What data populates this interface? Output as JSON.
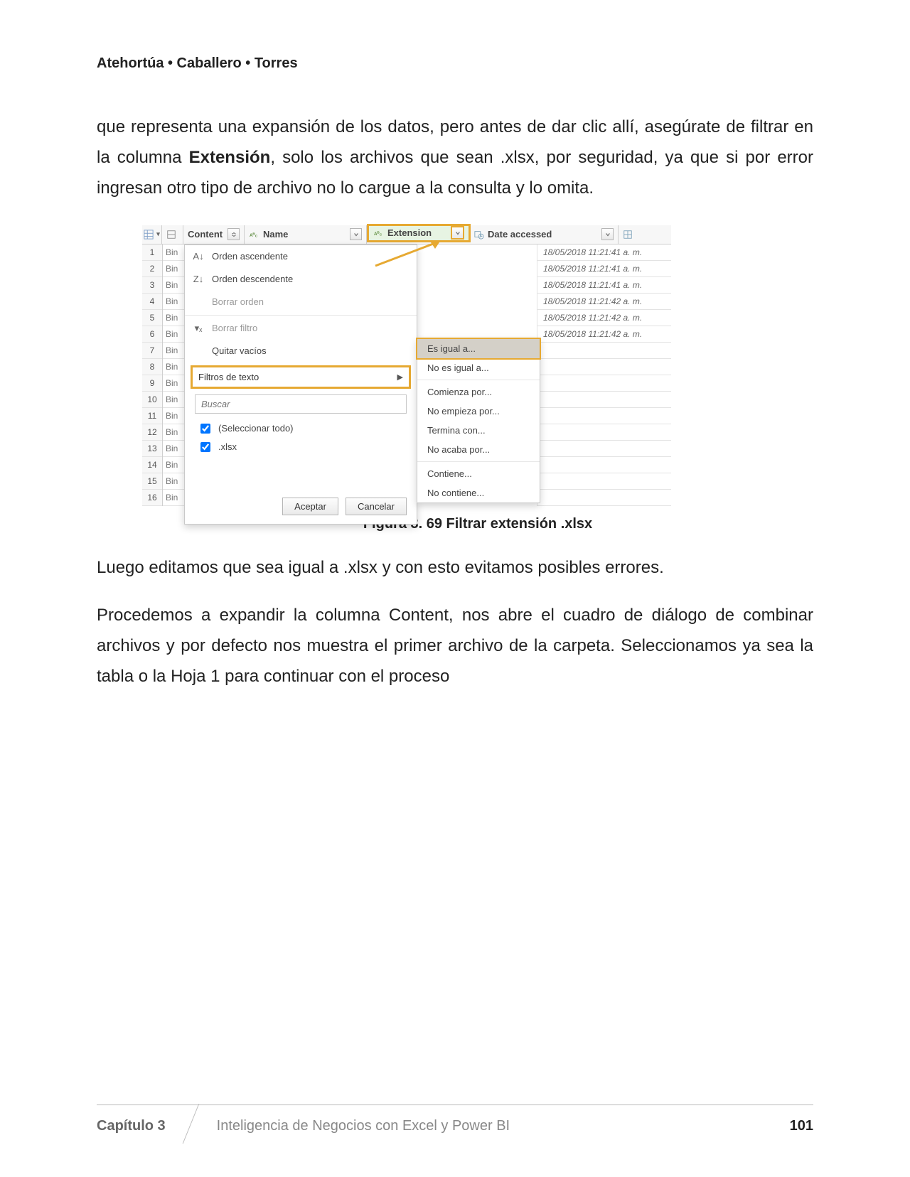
{
  "authors": "Atehortúa • Caballero • Torres",
  "para1_pre": "que representa una expansión de los datos, pero antes de dar clic allí, asegúrate de filtrar en la columna ",
  "para1_bold": "Extensión",
  "para1_post": ", solo los archivos que sean .xlsx, por seguridad, ya que si por error ingresan otro tipo de archivo no lo cargue a la consulta y lo omita.",
  "caption": "Figura 3. 69 Filtrar extensión .xlsx",
  "para2": "Luego editamos que sea igual a .xlsx y con esto evitamos posibles errores.",
  "para3": "Procedemos a expandir la columna Content, nos abre el cuadro de diálogo de combinar archivos y por defecto nos muestra el primer archivo de la carpeta. Seleccionamos ya sea la tabla o la Hoja 1 para continuar con el proceso",
  "footer": {
    "chapter": "Capítulo 3",
    "title": "Inteligencia de Negocios con Excel y Power BI",
    "page": "101"
  },
  "cols": {
    "content": "Content",
    "name": "Name",
    "extension": "Extension",
    "date": "Date accessed"
  },
  "rows": [
    "1",
    "2",
    "3",
    "4",
    "5",
    "6",
    "7",
    "8",
    "9",
    "10",
    "11",
    "12",
    "13",
    "14",
    "15",
    "16"
  ],
  "bin": "Bin",
  "dates": [
    "18/05/2018 11:21:41 a. m.",
    "18/05/2018 11:21:41 a. m.",
    "18/05/2018 11:21:41 a. m.",
    "18/05/2018 11:21:42 a. m.",
    "18/05/2018 11:21:42 a. m.",
    "18/05/2018 11:21:42 a. m."
  ],
  "menu": {
    "asc": "Orden ascendente",
    "desc": "Orden descendente",
    "clearSort": "Borrar orden",
    "clearFilter": "Borrar filtro",
    "removeEmpty": "Quitar vacíos",
    "textFilters": "Filtros de texto",
    "searchPlaceholder": "Buscar",
    "selectAll": "(Seleccionar todo)",
    "xlsx": ".xlsx",
    "ok": "Aceptar",
    "cancel": "Cancelar"
  },
  "submenu": {
    "equals": "Es igual a...",
    "notEquals": "No es igual a...",
    "beginsWith": "Comienza por...",
    "notBeginsWith": "No empieza por...",
    "endsWith": "Termina con...",
    "notEndsWith": "No acaba por...",
    "contains": "Contiene...",
    "notContains": "No contiene..."
  }
}
